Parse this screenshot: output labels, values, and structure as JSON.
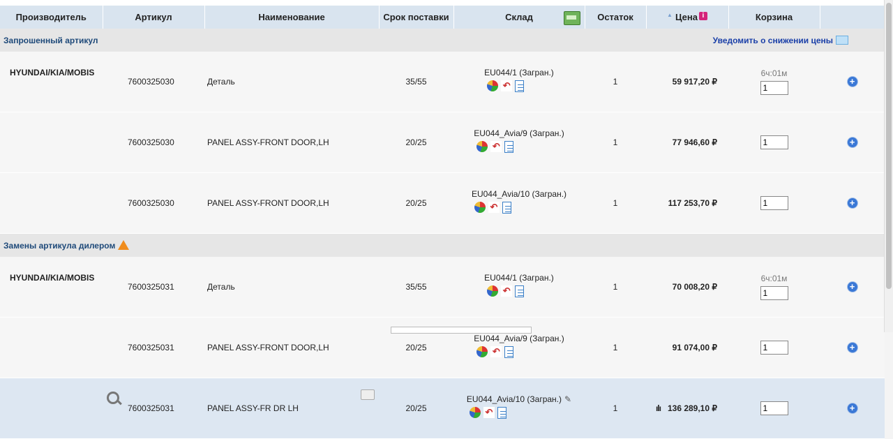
{
  "columns": [
    "Производитель",
    "Артикул",
    "Наименование",
    "Срок поставки",
    "Склад",
    "Остаток",
    "Цена",
    "Корзина"
  ],
  "groups": {
    "requested": {
      "label": "Запрошенный артикул",
      "notify": "Уведомить о снижении цены"
    },
    "replacements": {
      "label": "Замены артикула дилером"
    }
  },
  "rows": [
    {
      "mfr": "HYUNDAI/KIA/MOBIS",
      "art": "7600325030",
      "name": "Деталь",
      "term": "35/55",
      "wh": "EU044/1 (Загран.)",
      "stock": "1",
      "price": "59 917,20 ₽",
      "time": "6ч:01м",
      "qty": "1"
    },
    {
      "mfr": "",
      "art": "7600325030",
      "name": "PANEL ASSY-FRONT DOOR,LH",
      "term": "20/25",
      "wh": "EU044_Avia/9 (Загран.)",
      "stock": "1",
      "price": "77 946,60 ₽",
      "time": "",
      "qty": "1"
    },
    {
      "mfr": "",
      "art": "7600325030",
      "name": "PANEL ASSY-FRONT DOOR,LH",
      "term": "20/25",
      "wh": "EU044_Avia/10 (Загран.)",
      "stock": "1",
      "price": "117 253,70 ₽",
      "time": "",
      "qty": "1"
    },
    {
      "mfr": "HYUNDAI/KIA/MOBIS",
      "art": "7600325031",
      "name": "Деталь",
      "term": "35/55",
      "wh": "EU044/1 (Загран.)",
      "stock": "1",
      "price": "70 008,20 ₽",
      "time": "6ч:01м",
      "qty": "1"
    },
    {
      "mfr": "",
      "art": "7600325031",
      "name": "PANEL ASSY-FRONT DOOR,LH",
      "term": "20/25",
      "wh": "EU044_Avia/9 (Загран.)",
      "stock": "1",
      "price": "91 074,00 ₽",
      "time": "",
      "qty": "1"
    },
    {
      "mfr": "",
      "art": "7600325031",
      "name": "PANEL ASSY-FR DR LH",
      "term": "20/25",
      "wh": "EU044_Avia/10 (Загран.)",
      "stock": "1",
      "price": "136 289,10 ₽",
      "time": "",
      "qty": "1"
    }
  ]
}
